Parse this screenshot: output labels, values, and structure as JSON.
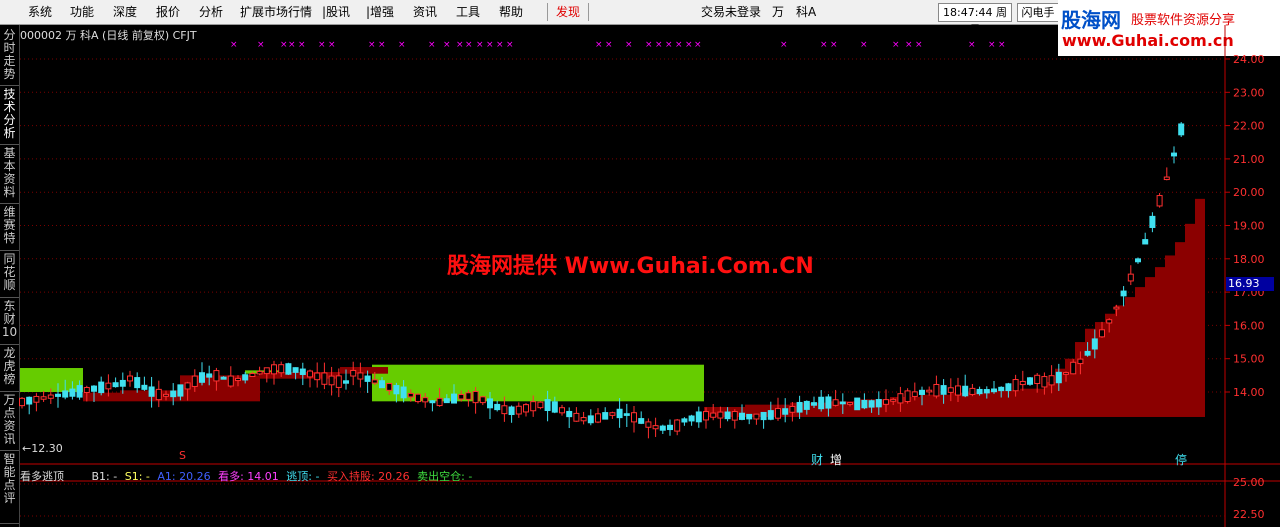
{
  "menu": {
    "items": [
      "系统",
      "功能",
      "深度",
      "报价",
      "分析",
      "扩展市场行情",
      "|股讯",
      "|增强",
      "资讯",
      "工具",
      "帮助",
      "发现"
    ],
    "center": "交易未登录",
    "stock_short": "万　科A",
    "clock": "18:47:44",
    "weekday": "周日",
    "flash": "闪电手"
  },
  "logo": {
    "title": "股海网",
    "slogan": "股票软件资源分享",
    "url": "www.Guhai.com.cn"
  },
  "sidebar": {
    "tabs": [
      "分时走势",
      "技术分析",
      "基本资料",
      "维赛特",
      "同花顺",
      "东财10",
      "龙虎榜",
      "万点资讯",
      "智能点评"
    ]
  },
  "stock": {
    "code": "000002",
    "name": "万 科A",
    "period": "(日线 前复权)",
    "formula": "CFJT"
  },
  "watermark": "股海网提供 Www.Guhai.Com.CN",
  "price_axis": {
    "labels": [
      "24.00",
      "23.00",
      "22.00",
      "21.00",
      "20.00",
      "19.00",
      "18.00",
      "17.00",
      "16.00",
      "15.00",
      "14.00"
    ],
    "lower_labels": [
      "25.00",
      "22.50"
    ],
    "current": "16.93"
  },
  "annotations": {
    "low_price": "←12.30",
    "marker_cai": "财",
    "marker_zeng": "增",
    "marker_ting": "停",
    "marker_s": "S"
  },
  "indicator": {
    "name": "看多逃顶",
    "b1": "B1: -",
    "s1": "S1: -",
    "a1": "A1: 20.26",
    "kanduo": "看多: 14.01",
    "taoding": "逃顶: -",
    "buy_hold": "买入持股: 20.26",
    "sell_empty": "卖出空仓: -"
  },
  "colors": {
    "up": "#ff3030",
    "down": "#40e0f0",
    "green_band": "#66cc00",
    "red_band": "#8b0000",
    "accent": "#ff00ff"
  }
}
